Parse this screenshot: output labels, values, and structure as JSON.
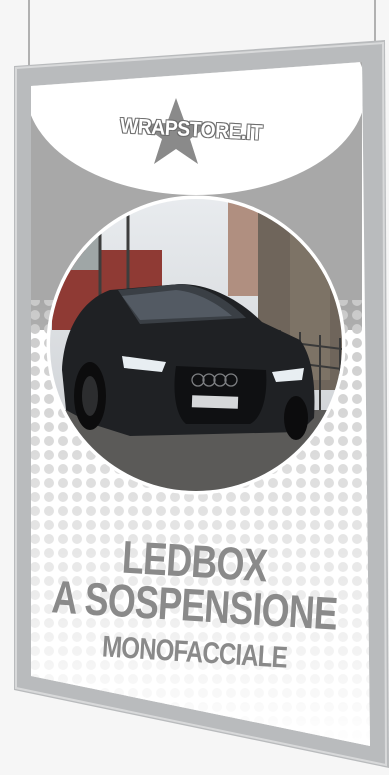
{
  "brand": {
    "logo_text": "WRAPSTORE.IT"
  },
  "headline": {
    "line1": "LEDBOX",
    "line2": "A SOSPENSIONE",
    "line3": "MONOFACCIALE"
  },
  "colors": {
    "frame": "#b9bbbd",
    "panel": "#ffffff",
    "accent_gray": "#a8a8a8",
    "text_gray": "#8a8a8a"
  },
  "icons": {
    "logo_mark": "star-icon"
  }
}
